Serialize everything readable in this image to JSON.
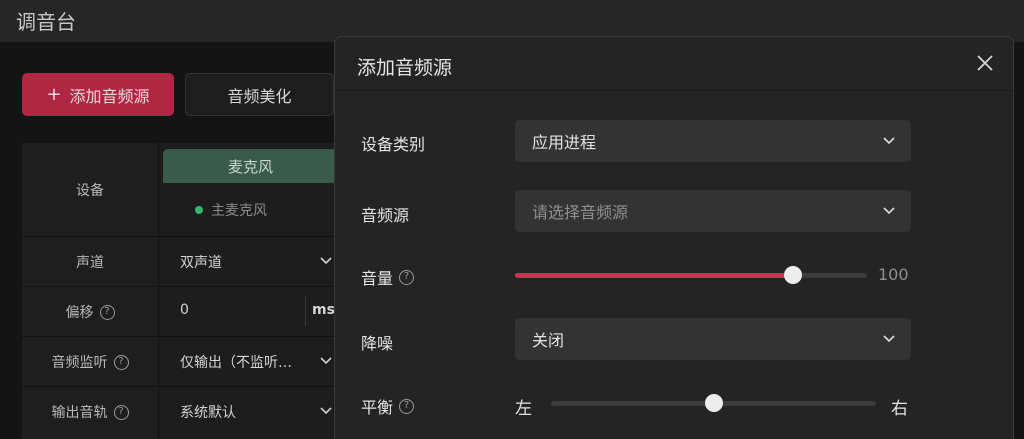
{
  "app": {
    "title": "调音台"
  },
  "toolbar": {
    "add_source_icon": "+",
    "add_source_label": "添加音频源",
    "beautify_label": "音频美化"
  },
  "mixer": {
    "rows": [
      {
        "label": "设备",
        "help": false
      },
      {
        "label": "声道",
        "help": false
      },
      {
        "label": "偏移",
        "help": true
      },
      {
        "label": "音频监听",
        "help": true
      },
      {
        "label": "输出音轨",
        "help": true
      }
    ],
    "channel": {
      "header": "麦克风",
      "device": "主麦克风",
      "device_status_color": "#37b46d",
      "channel_mode": "双声道",
      "offset_value": "0",
      "offset_unit": "ms",
      "monitor": "仅输出（不监听…",
      "output_track": "系统默认"
    }
  },
  "dialog": {
    "title": "添加音频源",
    "close_icon": "close-icon",
    "device_type": {
      "label": "设备类别",
      "value": "应用进程"
    },
    "source": {
      "label": "音频源",
      "placeholder": "请选择音频源"
    },
    "volume": {
      "label": "音量",
      "value": 100,
      "display": "100",
      "max": 100,
      "fill_ratio": 0.79
    },
    "noise": {
      "label": "降噪",
      "value": "关闭"
    },
    "balance": {
      "label": "平衡",
      "left": "左",
      "right": "右",
      "position": 0.5
    }
  },
  "colors": {
    "accent": "#d62e53",
    "add_button": "#b02743",
    "mic_header": "#3a5a4c"
  }
}
